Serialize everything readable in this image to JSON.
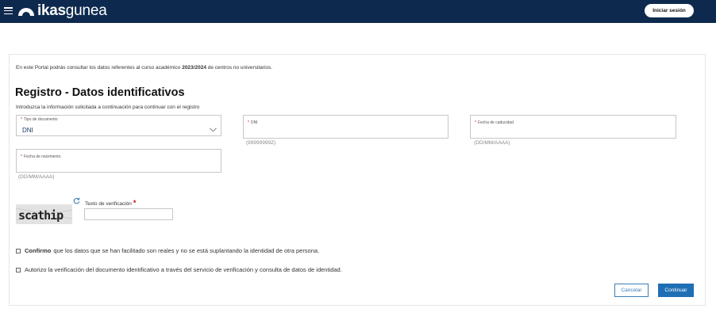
{
  "header": {
    "logo_bold": "ikas",
    "logo_light": "gunea",
    "login_label": "Iniciar sesión"
  },
  "intro": {
    "prefix": "En este Portal podrás consultar los datos referentes al curso académico ",
    "course": "2023/2024",
    "suffix": " de centros no universitarios."
  },
  "form": {
    "title": "Registro - Datos identificativos",
    "subtitle": "Introduzca la información solicitada a continuación para continuar con el registro",
    "doc_type": {
      "label": "Tipo de documento",
      "value": "DNI"
    },
    "dni": {
      "label": "DNI",
      "hint": "(99999999Z)"
    },
    "expiry": {
      "label": "Fecha de caducidad",
      "hint": "(DD/MM/AAAA)"
    },
    "birth": {
      "label": "Fecha de nacimiento",
      "hint": "(DD/MM/AAAA)"
    },
    "required_mark": "*",
    "captcha": {
      "image_text": "scathip",
      "label": "Texto de verificación"
    },
    "checks": [
      {
        "bold": "Confirmo",
        "text": "que los datos que se han facilitado son reales y no se está suplantando la identidad de otra persona."
      },
      {
        "bold": "",
        "text": "Autorizo la verificación del documento identificativo a través del servicio de verificación y consulta de datos de identidad."
      }
    ],
    "cancel_label": "Cancelar",
    "continue_label": "Continuar"
  },
  "colors": {
    "header_bg": "#0d2a4e",
    "primary": "#1f6fb4",
    "required": "#d0021b"
  }
}
